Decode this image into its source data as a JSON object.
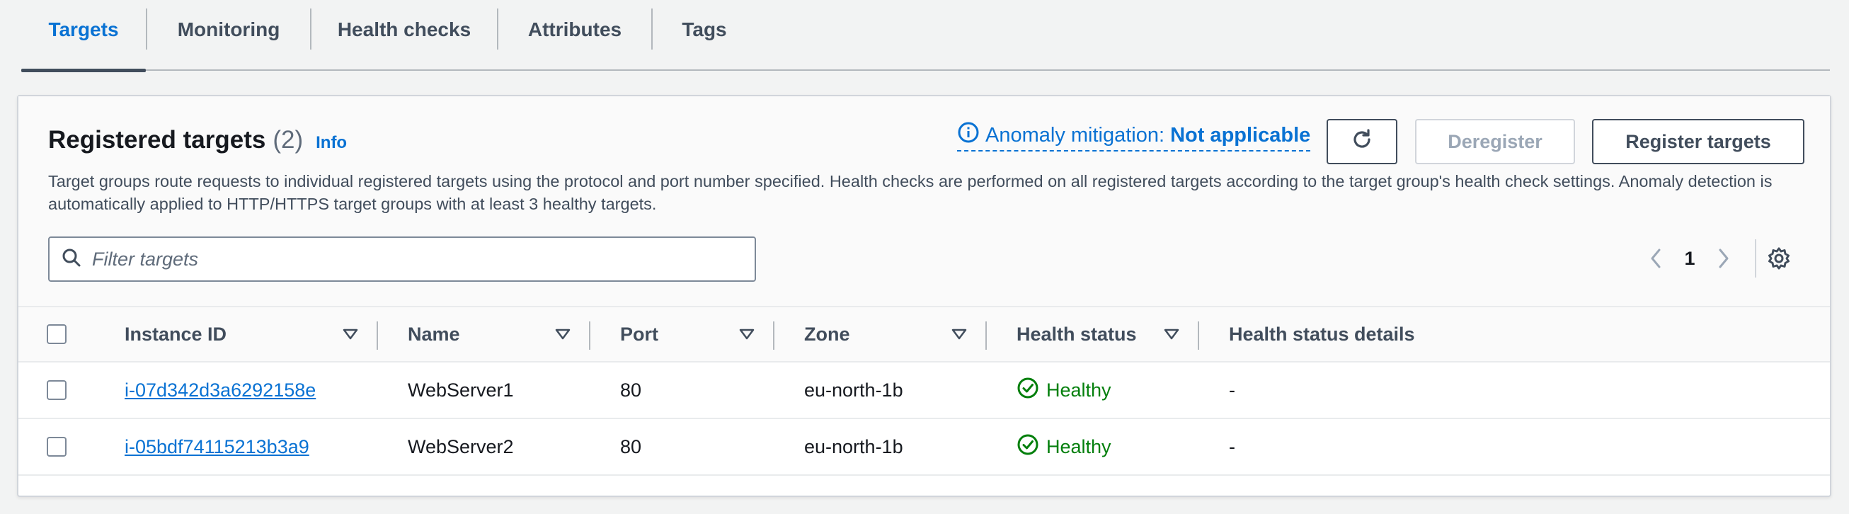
{
  "tabs": [
    {
      "label": "Targets",
      "active": true
    },
    {
      "label": "Monitoring",
      "active": false
    },
    {
      "label": "Health checks",
      "active": false
    },
    {
      "label": "Attributes",
      "active": false
    },
    {
      "label": "Tags",
      "active": false
    }
  ],
  "panel": {
    "title": "Registered targets",
    "count": "(2)",
    "info": "Info",
    "description": "Target groups route requests to individual registered targets using the protocol and port number specified. Health checks are performed on all registered targets according to the target group's health check settings. Anomaly detection is automatically applied to HTTP/HTTPS target groups with at least 3 healthy targets.",
    "anomaly_label": "Anomaly mitigation:",
    "anomaly_value": "Not applicable",
    "deregister_label": "Deregister",
    "register_label": "Register targets",
    "filter_placeholder": "Filter targets",
    "page": "1"
  },
  "table": {
    "columns": [
      "Instance ID",
      "Name",
      "Port",
      "Zone",
      "Health status",
      "Health status details"
    ],
    "rows": [
      {
        "instance_id": "i-07d342d3a6292158e",
        "name": "WebServer1",
        "port": "80",
        "zone": "eu-north-1b",
        "health": "Healthy",
        "details": "-"
      },
      {
        "instance_id": "i-05bdf74115213b3a9",
        "name": "WebServer2",
        "port": "80",
        "zone": "eu-north-1b",
        "health": "Healthy",
        "details": "-"
      }
    ]
  },
  "colors": {
    "accent": "#0972d3",
    "healthy": "#037f0c",
    "text": "#16191f",
    "muted": "#414d5c"
  },
  "icons": [
    "refresh-icon",
    "info-circle-icon",
    "search-icon",
    "chevron-left-icon",
    "chevron-right-icon",
    "gear-icon",
    "sort-caret-icon",
    "check-circle-icon"
  ]
}
